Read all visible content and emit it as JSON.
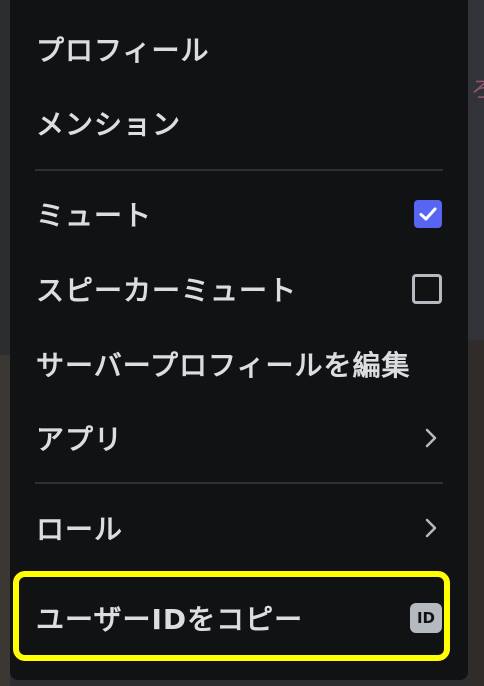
{
  "menu": {
    "items": [
      {
        "label": "プロフィール"
      },
      {
        "label": "メンション"
      },
      {
        "label": "ミュート",
        "checked": true
      },
      {
        "label": "スピーカーミュート",
        "checked": false
      },
      {
        "label": "サーバープロフィールを編集"
      },
      {
        "label": "アプリ",
        "icon": "chevron-right-icon"
      },
      {
        "label": "ロール",
        "icon": "chevron-right-icon"
      },
      {
        "label": "ユーザーIDをコピー",
        "icon": "id-badge-icon",
        "badge": "ID"
      }
    ]
  },
  "colors": {
    "menu_bg": "#111214",
    "text": "#dbdee1",
    "checkbox_checked": "#5865f2",
    "highlight": "#ffff00"
  }
}
